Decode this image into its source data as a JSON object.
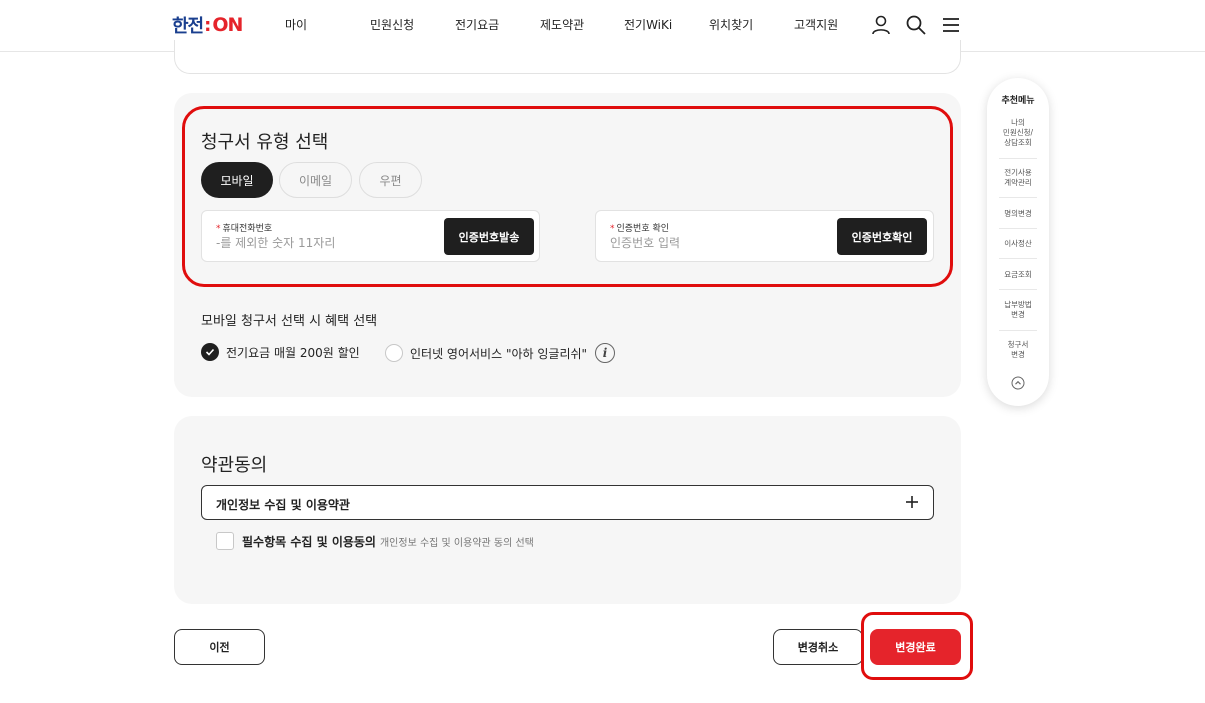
{
  "header": {
    "logo_main": "한전",
    "logo_colon": ":",
    "logo_on": "ON",
    "nav": [
      "마이",
      "민원신청",
      "전기요금",
      "제도약관",
      "전기WiKi",
      "위치찾기",
      "고객지원"
    ]
  },
  "bill_type": {
    "title": "청구서 유형 선택",
    "tabs": [
      "모바일",
      "이메일",
      "우편"
    ],
    "active_tab": "모바일",
    "phone_field": {
      "label": "휴대전화번호",
      "placeholder": "-를 제외한 숫자 11자리",
      "button": "인증번호발송"
    },
    "code_field": {
      "label": "인증번호 확인",
      "placeholder": "인증번호 입력",
      "button": "인증번호확인"
    }
  },
  "benefit": {
    "title": "모바일 청구서 선택 시 혜택 선택",
    "options": [
      {
        "label": "전기요금 매월 200원 할인",
        "selected": true
      },
      {
        "label": "인터넷 영어서비스 \"아하 잉글리쉬\"",
        "selected": false
      }
    ],
    "info_glyph": "i"
  },
  "terms": {
    "title": "약관동의",
    "accordion_label": "개인정보 수집 및 이용약관",
    "checkbox_label": "필수항목 수집 및 이용동의",
    "checkbox_sub": "개인정보 수집 및 이용약관 동의 선택"
  },
  "buttons": {
    "prev": "이전",
    "cancel": "변경취소",
    "complete": "변경완료"
  },
  "side_menu": {
    "title": "추천메뉴",
    "items": [
      "나의\n민원신청/\n상담조회",
      "전기사용\n계약관리",
      "명의변경",
      "이사정산",
      "요금조회",
      "납부방법\n변경",
      "청구서\n변경"
    ]
  },
  "colors": {
    "brand_blue": "#1a3f8f",
    "brand_red": "#e5242b",
    "highlight_red": "#e00d0d",
    "dark": "#1f1f1f"
  }
}
